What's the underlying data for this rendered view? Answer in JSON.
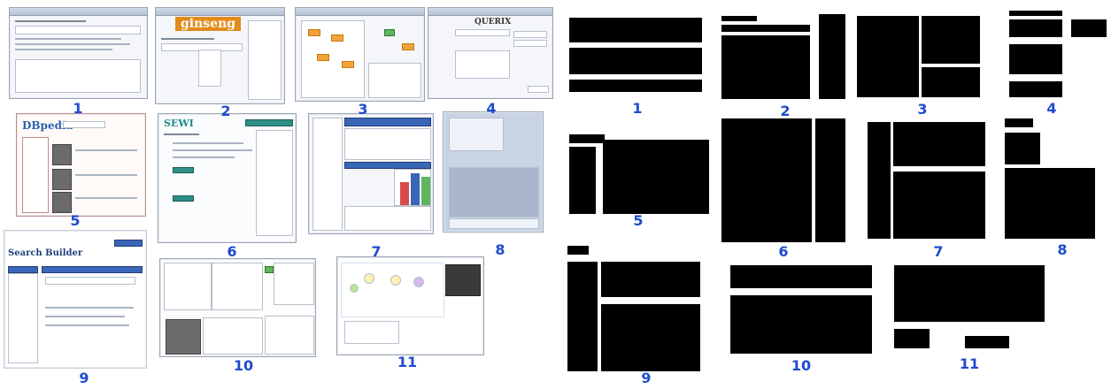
{
  "labels": [
    "1",
    "2",
    "3",
    "4",
    "5",
    "6",
    "7",
    "8",
    "9",
    "10",
    "11"
  ],
  "brands": {
    "ginseng": "ginseng",
    "querix": "QUERIX",
    "dbpedia": "DBpedia",
    "search_builder": "Search Builder",
    "sewi": "SEWI"
  },
  "colors": {
    "label": "#1f4bd0",
    "redact": "#000000",
    "orange": "#f2a23a",
    "green": "#5fb55f",
    "blue": "#3a66b8",
    "red": "#d94a4a"
  }
}
